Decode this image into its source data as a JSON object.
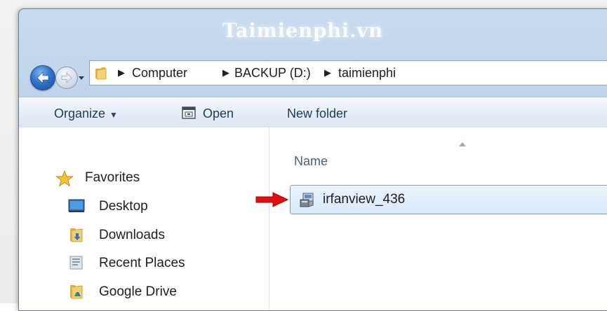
{
  "watermark": "Taimienphi.vn",
  "address_bar": {
    "crumbs": [
      "Computer",
      "BACKUP (D:)",
      "taimienphi"
    ]
  },
  "toolbar": {
    "organize_label": "Organize",
    "open_label": "Open",
    "new_folder_label": "New folder"
  },
  "nav_pane": {
    "favorites_label": "Favorites",
    "items": [
      {
        "label": "Desktop",
        "icon": "desktop-icon"
      },
      {
        "label": "Downloads",
        "icon": "downloads-folder-icon"
      },
      {
        "label": "Recent Places",
        "icon": "recent-places-icon"
      },
      {
        "label": "Google Drive",
        "icon": "google-drive-folder-icon"
      }
    ]
  },
  "file_list": {
    "column_name": "Name",
    "files": [
      {
        "name": "irfanview_436",
        "icon": "installer-icon",
        "selected": true
      }
    ]
  },
  "colors": {
    "window_frame": "#bcd2ea",
    "selection": "#d9e9fb",
    "annotation_arrow": "#e01010"
  }
}
